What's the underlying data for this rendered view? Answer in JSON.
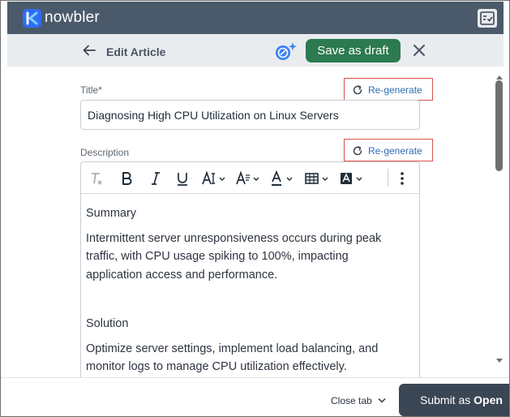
{
  "app": {
    "brand": "nowbler"
  },
  "header": {
    "title": "Edit Article",
    "save_draft_label": "Save as draft"
  },
  "form": {
    "title_label": "Title*",
    "title_value": "Diagnosing High CPU Utilization on Linux Servers",
    "description_label": "Description",
    "regenerate_label": "Re-generate"
  },
  "toolbar": {
    "icons": [
      "clear-format-icon",
      "bold-icon",
      "italic-icon",
      "underline-icon",
      "font-size-icon",
      "paragraph-format-icon",
      "text-color-icon",
      "table-icon",
      "highlight-icon",
      "more-options-icon"
    ]
  },
  "editor": {
    "summary_heading": "Summary",
    "summary_text": "Intermittent server unresponsiveness occurs during peak traffic, with CPU usage spiking to 100%, impacting application access and performance.",
    "solution_heading": "Solution",
    "solution_text": "Optimize server settings, implement load balancing, and monitor logs to manage CPU utilization effectively."
  },
  "footer": {
    "close_tab_label": "Close tab",
    "submit_prefix": "Submit as ",
    "submit_status": "Open"
  },
  "colors": {
    "appbar": "#4a5a6b",
    "draft_button": "#2c7a4f",
    "regenerate_border": "#d9534f",
    "link": "#2f6db5",
    "submit_button": "#3b4654"
  }
}
